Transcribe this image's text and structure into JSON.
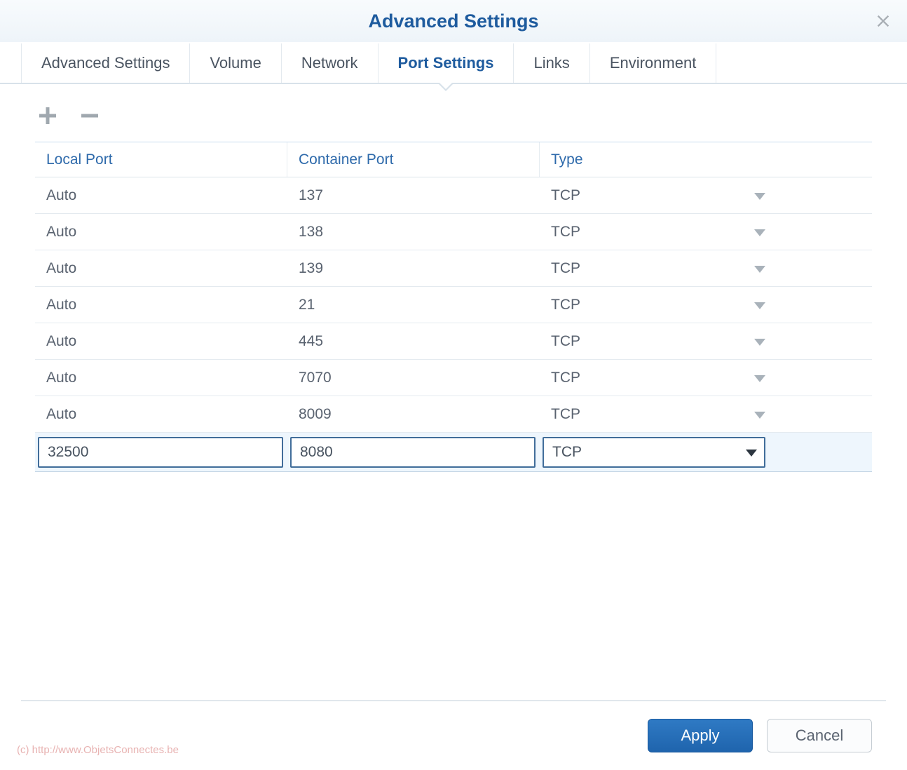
{
  "dialog": {
    "title": "Advanced Settings"
  },
  "tabs": [
    {
      "label": "Advanced Settings",
      "active": false
    },
    {
      "label": "Volume",
      "active": false
    },
    {
      "label": "Network",
      "active": false
    },
    {
      "label": "Port Settings",
      "active": true
    },
    {
      "label": "Links",
      "active": false
    },
    {
      "label": "Environment",
      "active": false
    }
  ],
  "columns": {
    "local_port": "Local Port",
    "container_port": "Container Port",
    "type": "Type"
  },
  "rows": [
    {
      "local": "Auto",
      "container": "137",
      "type": "TCP",
      "editing": false
    },
    {
      "local": "Auto",
      "container": "138",
      "type": "TCP",
      "editing": false
    },
    {
      "local": "Auto",
      "container": "139",
      "type": "TCP",
      "editing": false
    },
    {
      "local": "Auto",
      "container": "21",
      "type": "TCP",
      "editing": false
    },
    {
      "local": "Auto",
      "container": "445",
      "type": "TCP",
      "editing": false
    },
    {
      "local": "Auto",
      "container": "7070",
      "type": "TCP",
      "editing": false
    },
    {
      "local": "Auto",
      "container": "8009",
      "type": "TCP",
      "editing": false
    },
    {
      "local": "32500",
      "container": "8080",
      "type": "TCP",
      "editing": true
    }
  ],
  "buttons": {
    "apply": "Apply",
    "cancel": "Cancel"
  },
  "watermark": "(c) http://www.ObjetsConnectes.be"
}
